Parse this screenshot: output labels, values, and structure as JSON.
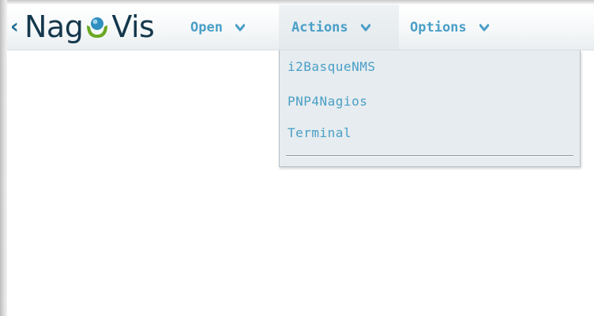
{
  "app": {
    "logo_left": "Nag",
    "logo_right": "Vis",
    "back_icon": "back-chevron-icon"
  },
  "menubar": {
    "items": [
      {
        "label": "Open",
        "icon": "chevron-down-icon"
      },
      {
        "label": "Actions",
        "icon": "chevron-down-icon",
        "active": true
      },
      {
        "label": "Options",
        "icon": "chevron-down-icon"
      }
    ]
  },
  "actions_dropdown": {
    "items": [
      {
        "label": "i2BasqueNMS"
      },
      {
        "label": "PNP4Nagios"
      },
      {
        "label": "Terminal"
      }
    ]
  },
  "colors": {
    "menu_text": "#4a9fc7",
    "logo_text": "#15384d",
    "dropdown_bg": "#e6ecef",
    "logo_green": "#6aa820",
    "logo_blue": "#2f8fc0"
  }
}
